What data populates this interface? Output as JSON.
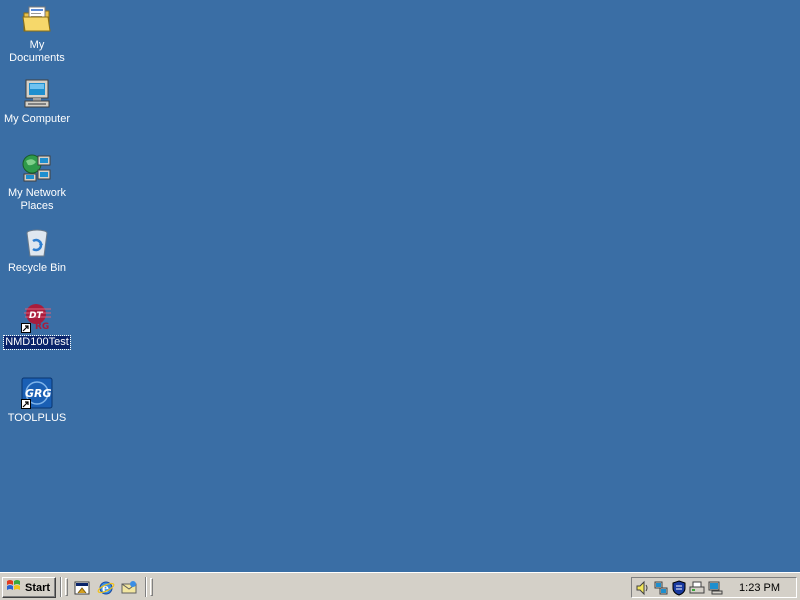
{
  "desktop": {
    "icons": [
      {
        "label": "My Documents",
        "icon": "folder-documents-icon"
      },
      {
        "label": "My Computer",
        "icon": "computer-icon"
      },
      {
        "label": "My Network Places",
        "icon": "network-places-icon"
      },
      {
        "label": "Recycle Bin",
        "icon": "recycle-bin-icon"
      },
      {
        "label": "NMD100Test",
        "icon": "nmd100test-shortcut-icon",
        "selected": true
      },
      {
        "label": "TOOLPLUS",
        "icon": "grg-toolplus-shortcut-icon"
      }
    ],
    "background_color": "#3a6ea5"
  },
  "taskbar": {
    "start_label": "Start",
    "quick_launch": [
      "show-desktop-icon",
      "internet-explorer-icon",
      "outlook-express-icon"
    ],
    "tray": {
      "icons": [
        "volume-icon",
        "network-connection-icon",
        "security-shield-icon",
        "printer-icon",
        "display-icon"
      ],
      "clock": "1:23 PM"
    }
  }
}
